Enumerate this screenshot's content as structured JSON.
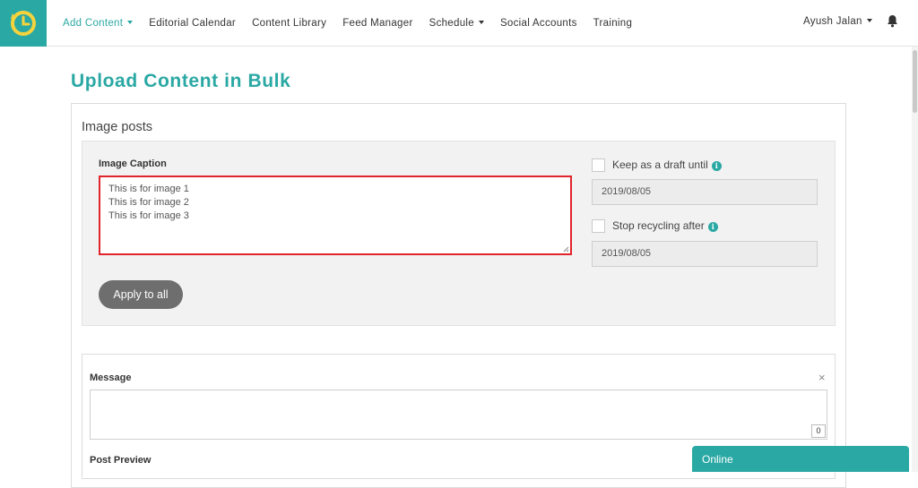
{
  "nav": {
    "items": [
      {
        "label": "Add Content",
        "has_caret": true
      },
      {
        "label": "Editorial Calendar"
      },
      {
        "label": "Content Library"
      },
      {
        "label": "Feed Manager"
      },
      {
        "label": "Schedule",
        "has_caret": true
      },
      {
        "label": "Social Accounts"
      },
      {
        "label": "Training"
      }
    ],
    "user_name": "Ayush Jalan",
    "active_color": "#2aa8a4"
  },
  "page": {
    "title": "Upload Content in Bulk",
    "section_title": "Image posts"
  },
  "bulk": {
    "caption_label": "Image Caption",
    "caption_value": "This is for image 1\nThis is for image 2\nThis is for image 3",
    "apply_label": "Apply to all",
    "draft_label": "Keep as a draft until",
    "draft_date": "2019/08/05",
    "recycle_label": "Stop recycling after",
    "recycle_date": "2019/08/05",
    "info_icon_glyph": "i"
  },
  "message": {
    "label": "Message",
    "close_glyph": "×",
    "char_count": "0",
    "preview_label": "Post Preview"
  },
  "chat": {
    "status": "Online"
  },
  "icons": {
    "logo": "clock-refresh-icon",
    "notifications": "bell-icon",
    "info": "info-icon",
    "close": "close-icon"
  },
  "colors": {
    "brand": "#2aa8a4",
    "highlight": "#e0262c",
    "button": "#6e6e6e"
  }
}
